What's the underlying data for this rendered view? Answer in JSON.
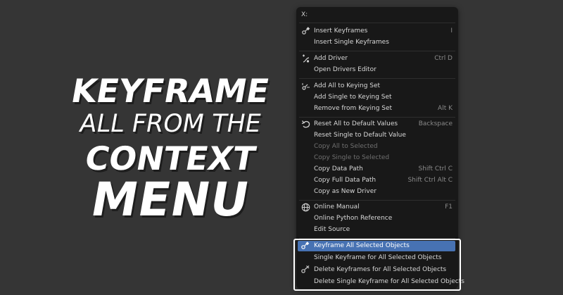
{
  "headline": {
    "line1": "KEYFRAME",
    "line2": "ALL FROM THE",
    "line3": "CONTEXT",
    "line4": "MENU"
  },
  "menu": {
    "title": "X:",
    "items": [
      {
        "label": "Insert Keyframes",
        "shortcut": "I",
        "icon": "keyframe-insert-icon"
      },
      {
        "label": "Insert Single Keyframes",
        "shortcut": ""
      },
      {
        "label": "Add Driver",
        "shortcut": "Ctrl D",
        "icon": "driver-icon"
      },
      {
        "label": "Open Drivers Editor",
        "shortcut": ""
      },
      {
        "label": "Add All to Keying Set",
        "shortcut": "",
        "icon": "keying-set-icon"
      },
      {
        "label": "Add Single to Keying Set",
        "shortcut": ""
      },
      {
        "label": "Remove from Keying Set",
        "shortcut": "Alt K"
      },
      {
        "label": "Reset All to Default Values",
        "shortcut": "Backspace",
        "icon": "reset-icon"
      },
      {
        "label": "Reset Single to Default Value",
        "shortcut": ""
      },
      {
        "label": "Copy All to Selected",
        "shortcut": "",
        "disabled": true
      },
      {
        "label": "Copy Single to Selected",
        "shortcut": "",
        "disabled": true
      },
      {
        "label": "Copy Data Path",
        "shortcut": "Shift Ctrl C"
      },
      {
        "label": "Copy Full Data Path",
        "shortcut": "Shift Ctrl Alt C"
      },
      {
        "label": "Copy as New Driver",
        "shortcut": ""
      },
      {
        "label": "Online Manual",
        "shortcut": "F1",
        "icon": "globe-icon"
      },
      {
        "label": "Online Python Reference",
        "shortcut": ""
      },
      {
        "label": "Edit Source",
        "shortcut": ""
      }
    ],
    "new_items": [
      {
        "label": "Keyframe All Selected Objects",
        "icon": "keyframe-insert-icon",
        "highlighted": true
      },
      {
        "label": "Single Keyframe for All Selected Objects"
      },
      {
        "label": "Delete Keyframes for All Selected Objects",
        "icon": "keyframe-delete-icon"
      },
      {
        "label": "Delete Single Keyframe for All Selected Objects"
      }
    ]
  },
  "colors": {
    "background": "#353535",
    "menu_bg": "#181818",
    "highlight": "#4772b3",
    "frame": "#ffffff"
  }
}
